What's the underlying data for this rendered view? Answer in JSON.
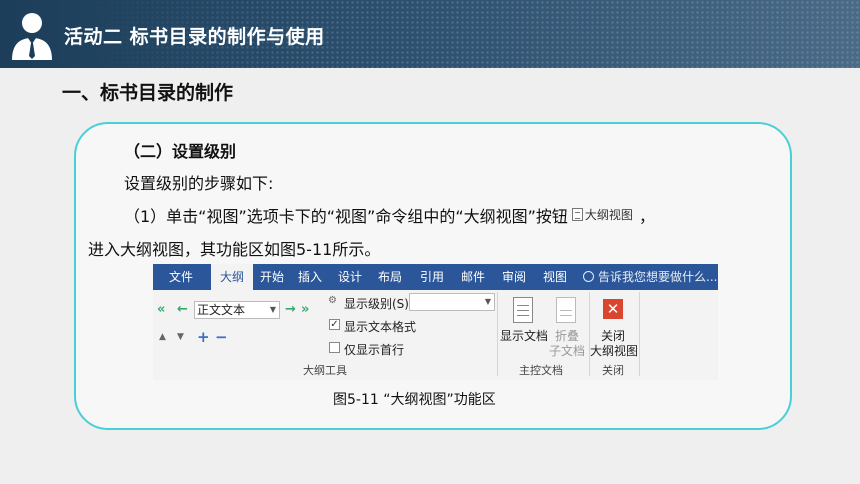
{
  "header": {
    "title": "活动二  标书目录的制作与使用"
  },
  "section": {
    "title": "一、标书目录的制作"
  },
  "content": {
    "subtitle": "（二）设置级别",
    "line1": "设置级别的步骤如下:",
    "line2_before": "（1）单击“视图”选项卡下的“视图”命令组中的“大纲视图”按钮",
    "inline_button_label": "大纲视图",
    "line2_after": "，",
    "line3": "进入大纲视图，其功能区如图5-11所示。",
    "caption": "图5-11   “大纲视图”功能区"
  },
  "ribbon": {
    "tabs": [
      "文件",
      "大纲",
      "开始",
      "插入",
      "设计",
      "布局",
      "引用",
      "邮件",
      "审阅",
      "视图"
    ],
    "active_tab": "大纲",
    "tell_me": "告诉我您想要做什么...",
    "level_combo": "正文文本",
    "show_level_label": "显示级别(S):",
    "show_level_value": "",
    "show_text_format": "显示文本格式",
    "show_text_format_checked": true,
    "show_first_line": "仅显示首行",
    "show_first_line_checked": false,
    "outline_tools_label": "大纲工具",
    "show_document": "显示文档",
    "collapse_line1": "折叠",
    "collapse_line2": "子文档",
    "master_doc_label": "主控文档",
    "close_line1": "关闭",
    "close_line2": "大纲视图",
    "close_group_label": "关闭"
  },
  "colors": {
    "banner": "#1c3e5a",
    "card_border": "#48cfd7",
    "ribbon_tabbar": "#2b579a",
    "close_icon": "#d9452f",
    "promote_arrows": "#3aa96b"
  }
}
